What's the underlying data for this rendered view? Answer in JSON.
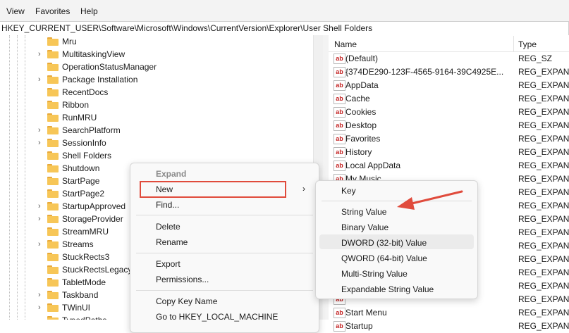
{
  "menubar": {
    "items": [
      "View",
      "Favorites",
      "Help"
    ]
  },
  "address": "HKEY_CURRENT_USER\\Software\\Microsoft\\Windows\\CurrentVersion\\Explorer\\User Shell Folders",
  "tree": {
    "items": [
      {
        "label": "Mru",
        "chevron": false
      },
      {
        "label": "MultitaskingView",
        "chevron": true
      },
      {
        "label": "OperationStatusManager",
        "chevron": false
      },
      {
        "label": "Package Installation",
        "chevron": true
      },
      {
        "label": "RecentDocs",
        "chevron": false
      },
      {
        "label": "Ribbon",
        "chevron": false
      },
      {
        "label": "RunMRU",
        "chevron": false
      },
      {
        "label": "SearchPlatform",
        "chevron": true
      },
      {
        "label": "SessionInfo",
        "chevron": true
      },
      {
        "label": "Shell Folders",
        "chevron": false
      },
      {
        "label": "Shutdown",
        "chevron": false
      },
      {
        "label": "StartPage",
        "chevron": false
      },
      {
        "label": "StartPage2",
        "chevron": false
      },
      {
        "label": "StartupApproved",
        "chevron": true
      },
      {
        "label": "StorageProvider",
        "chevron": true
      },
      {
        "label": "StreamMRU",
        "chevron": false
      },
      {
        "label": "Streams",
        "chevron": true
      },
      {
        "label": "StuckRects3",
        "chevron": false
      },
      {
        "label": "StuckRectsLegacy",
        "chevron": false
      },
      {
        "label": "TabletMode",
        "chevron": false
      },
      {
        "label": "Taskband",
        "chevron": true
      },
      {
        "label": "TWinUI",
        "chevron": true
      },
      {
        "label": "TypedPaths",
        "chevron": false
      }
    ]
  },
  "values": {
    "col_name": "Name",
    "col_type": "Type",
    "rows": [
      {
        "name": "(Default)",
        "type": "REG_SZ"
      },
      {
        "name": "{374DE290-123F-4565-9164-39C4925E...",
        "type": "REG_EXPAN"
      },
      {
        "name": "AppData",
        "type": "REG_EXPAN"
      },
      {
        "name": "Cache",
        "type": "REG_EXPAN"
      },
      {
        "name": "Cookies",
        "type": "REG_EXPAN"
      },
      {
        "name": "Desktop",
        "type": "REG_EXPAN"
      },
      {
        "name": "Favorites",
        "type": "REG_EXPAN"
      },
      {
        "name": "History",
        "type": "REG_EXPAN"
      },
      {
        "name": "Local AppData",
        "type": "REG_EXPAN"
      },
      {
        "name": "My Music",
        "type": "REG_EXPAN"
      },
      {
        "name": "",
        "type": "REG_EXPAN"
      },
      {
        "name": "",
        "type": "REG_EXPAN"
      },
      {
        "name": "",
        "type": "REG_EXPAN"
      },
      {
        "name": "",
        "type": "REG_EXPAN"
      },
      {
        "name": "",
        "type": "REG_EXPAN"
      },
      {
        "name": "",
        "type": "REG_EXPAN"
      },
      {
        "name": "",
        "type": "REG_EXPAN"
      },
      {
        "name": "",
        "type": "REG_EXPAN"
      },
      {
        "name": "",
        "type": "REG_EXPAN"
      },
      {
        "name": "Start Menu",
        "type": "REG_EXPAN"
      },
      {
        "name": "Startup",
        "type": "REG_EXPAN"
      }
    ]
  },
  "context_menu": {
    "expand": "Expand",
    "new": "New",
    "find": "Find...",
    "delete": "Delete",
    "rename": "Rename",
    "export": "Export",
    "permissions": "Permissions...",
    "copy_key_name": "Copy Key Name",
    "goto": "Go to HKEY_LOCAL_MACHINE"
  },
  "submenu": {
    "key": "Key",
    "string_value": "String Value",
    "binary_value": "Binary Value",
    "dword": "DWORD (32-bit) Value",
    "qword": "QWORD (64-bit) Value",
    "multi_string": "Multi-String Value",
    "expandable_string": "Expandable String Value"
  },
  "colors": {
    "highlight_box": "#e04b3c",
    "arrow": "#e04b3c",
    "folder": "#f7c657"
  }
}
